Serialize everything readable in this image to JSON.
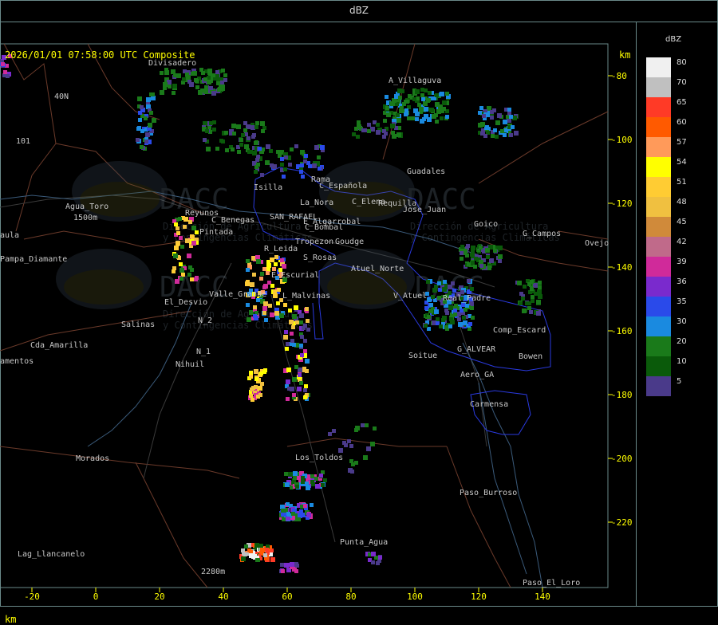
{
  "window": {
    "title": "dBZ"
  },
  "header": {
    "timestamp": "2026/01/01 07:58:00 UTC Composite",
    "km_unit": "km"
  },
  "legend": {
    "title": "dBZ",
    "items": [
      {
        "value": "80",
        "color": "#f0f0f0"
      },
      {
        "value": "70",
        "color": "#c0c0c0"
      },
      {
        "value": "65",
        "color": "#ff3a26"
      },
      {
        "value": "60",
        "color": "#ff5a00"
      },
      {
        "value": "57",
        "color": "#ff9a5a"
      },
      {
        "value": "54",
        "color": "#ffff00"
      },
      {
        "value": "51",
        "color": "#ffcc33"
      },
      {
        "value": "48",
        "color": "#f0c040"
      },
      {
        "value": "45",
        "color": "#d08a3a"
      },
      {
        "value": "42",
        "color": "#c06a8a"
      },
      {
        "value": "39",
        "color": "#d02a9a"
      },
      {
        "value": "36",
        "color": "#7a2acd"
      },
      {
        "value": "35",
        "color": "#2a4aea"
      },
      {
        "value": "30",
        "color": "#1a8ae0"
      },
      {
        "value": "20",
        "color": "#1a7a1a"
      },
      {
        "value": "10",
        "color": "#0a5a0a"
      },
      {
        "value": "5",
        "color": "#4a3a8a"
      }
    ]
  },
  "axes": {
    "x_unit": "km",
    "y_unit": "km",
    "x_ticks": [
      -20,
      0,
      20,
      40,
      60,
      80,
      100,
      120,
      140
    ],
    "y_ticks": [
      -80,
      -100,
      -120,
      -140,
      -160,
      -180,
      -200,
      -220
    ]
  },
  "places": [
    "Divisadero",
    "A_Villaguva",
    "40N",
    "101",
    "Agua_Toro",
    "1500m",
    "aula",
    "Pampa_Diamante",
    "El_Desvio",
    "Salinas",
    "Cda_Amarilla",
    "amentos",
    "N_2",
    "N_1",
    "Nihuil",
    "Morados",
    "Lag_Llancanelo",
    "Guadales",
    "Isilla",
    "C_Española",
    "Rama",
    "La_Nora",
    "C_Elena",
    "Requilla",
    "Jose_Juan",
    "Reyunos",
    "Pintada",
    "C_Benegas",
    "SAN_RAFAEL",
    "E_Algarrobal",
    "C_Bombal",
    "Tropezon",
    "Goudge",
    "R_Leida",
    "S_Rosas",
    "Atuel_Norte",
    "E_Escurial",
    "Valle_Grande",
    "L_Malvinas",
    "V_Atuel",
    "Goico",
    "G_Campos",
    "Ovejo",
    "Real_Padre",
    "Comp_Escard",
    "Soitue",
    "G_ALVEAR",
    "Bowen",
    "Aero_GA",
    "Carmensa",
    "Los_Toldos",
    "Paso_Burroso",
    "Punta_Agua",
    "Paso_El_Loro",
    "2280m"
  ],
  "watermark": {
    "logo": "DACC",
    "line1": "Dirección de Agricultura",
    "line2": "y Contingencias Climáticas"
  }
}
